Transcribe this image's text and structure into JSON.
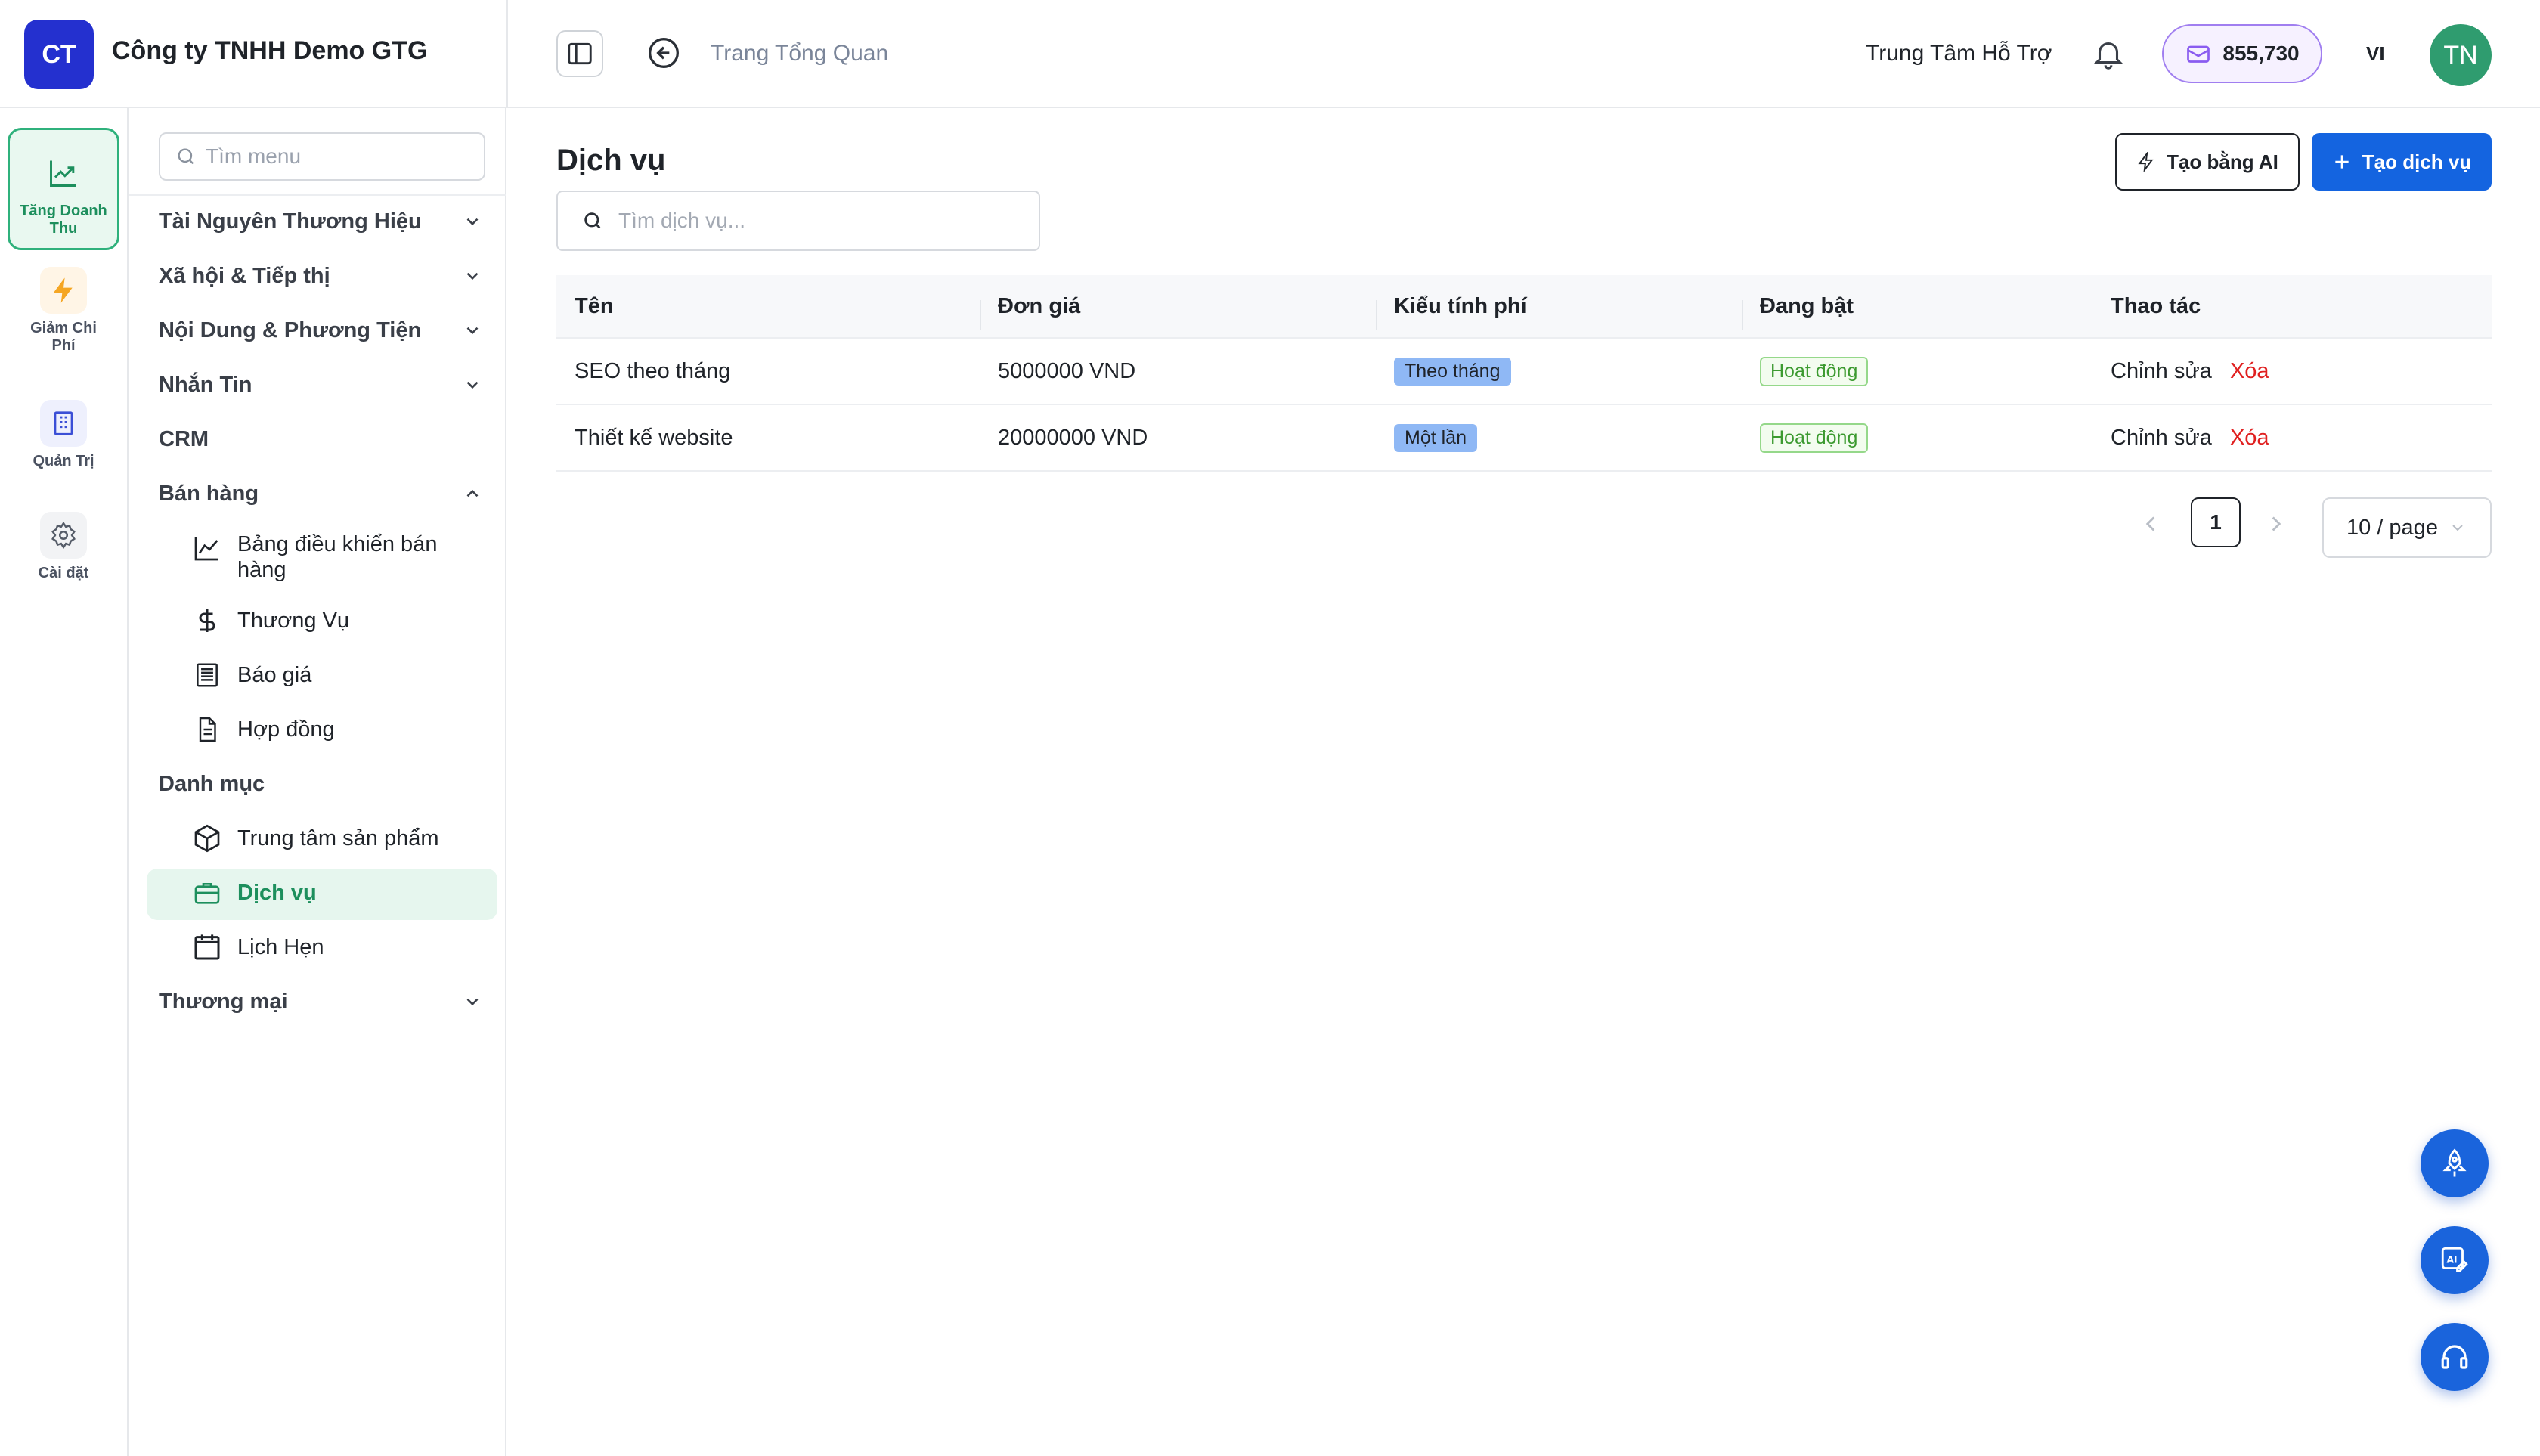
{
  "header": {
    "logo_text": "CT",
    "company": "Công ty TNHH Demo GTG",
    "breadcrumb": "Trang Tổng Quan",
    "support": "Trung Tâm Hỗ Trợ",
    "credits": "855,730",
    "language": "VI",
    "avatar_initials": "TN",
    "brand_color": "#2430cf",
    "avatar_color": "#2f9c6f"
  },
  "rail": {
    "items": [
      {
        "label_1": "Tăng Doanh",
        "label_2": "Thu",
        "icon": "trending-up-icon"
      },
      {
        "label_1": "Giảm Chi",
        "label_2": "Phí",
        "icon": "lightning-icon"
      },
      {
        "label_1": "Quản Trị",
        "icon": "building-icon"
      },
      {
        "label_1": "Cài đặt",
        "icon": "gear-icon"
      }
    ]
  },
  "sidebar": {
    "search_placeholder": "Tìm menu",
    "groups": {
      "brand": "Tài Nguyên Thương Hiệu",
      "social": "Xã hội & Tiếp thị",
      "content": "Nội Dung & Phương Tiện",
      "messages": "Nhắn Tin",
      "crm": "CRM",
      "sales": "Bán hàng",
      "catalog": "Danh mục",
      "commerce": "Thương mại"
    },
    "sales_items": {
      "dashboard_1": "Bảng điều khiển bán",
      "dashboard_2": "hàng",
      "deals": "Thương Vụ",
      "quotes": "Báo giá",
      "contracts": "Hợp đồng"
    },
    "catalog_items": {
      "products": "Trung tâm sản phẩm",
      "services": "Dịch vụ",
      "appointments": "Lịch Hẹn"
    }
  },
  "main": {
    "title": "Dịch vụ",
    "ai_button": "Tạo bằng AI",
    "create_button": "Tạo dịch vụ",
    "search_placeholder": "Tìm dịch vụ...",
    "columns": [
      "Tên",
      "Đơn giá",
      "Kiểu tính phí",
      "Đang bật",
      "Thao tác"
    ],
    "rows": [
      {
        "name": "SEO theo tháng",
        "price": "5000000 VND",
        "billing": "Theo tháng",
        "status": "Hoạt động",
        "edit": "Chỉnh sửa",
        "delete": "Xóa"
      },
      {
        "name": "Thiết kế website",
        "price": "20000000 VND",
        "billing": "Một lần",
        "status": "Hoạt động",
        "edit": "Chỉnh sửa",
        "delete": "Xóa"
      }
    ],
    "pagination": {
      "current_page": "1",
      "page_size": "10 / page"
    }
  }
}
